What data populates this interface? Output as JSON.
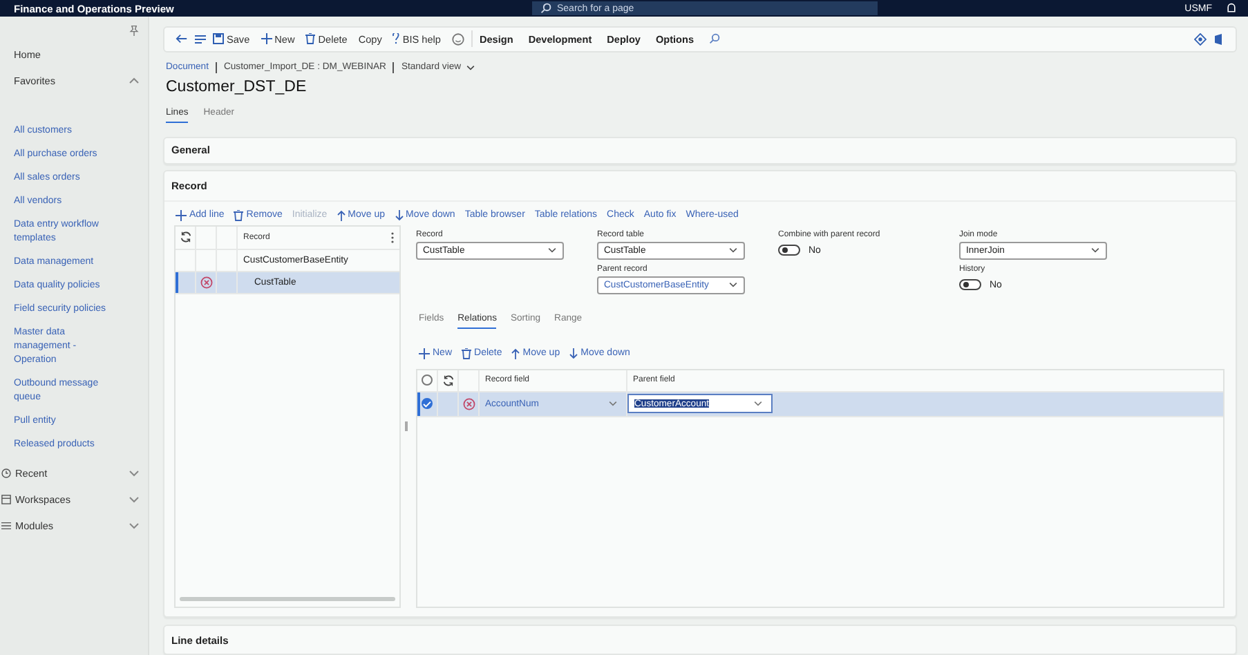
{
  "top_bar": {
    "app_title": "Finance and Operations Preview",
    "search": {
      "placeholder": "Search for a page"
    },
    "company": "USMF"
  },
  "sidebar": {
    "home": "Home",
    "favorites": {
      "label": "Favorites",
      "expanded": true,
      "items": [
        "All customers",
        "All purchase orders",
        "All sales orders",
        "All vendors",
        "Data entry workflow templates",
        "Data management",
        "Data quality policies",
        "Field security policies",
        "Master data management - Operation",
        "Outbound message queue",
        "Pull entity",
        "Released products"
      ]
    },
    "groups": [
      {
        "label": "Recent",
        "kind": "clock",
        "expanded": false
      },
      {
        "label": "Workspaces",
        "kind": "board",
        "expanded": false
      },
      {
        "label": "Modules",
        "kind": "list",
        "expanded": false
      }
    ]
  },
  "toolbar": {
    "actions": [
      {
        "label": "Save",
        "kind": "save"
      },
      {
        "label": "New",
        "kind": "plus"
      },
      {
        "label": "Delete",
        "kind": "trash"
      },
      {
        "label": "Copy",
        "kind": "plain"
      },
      {
        "label": "BIS help",
        "kind": "question"
      }
    ],
    "menus": [
      "Design",
      "Development",
      "Deploy",
      "Options"
    ]
  },
  "breadcrumb": {
    "link": "Document",
    "context": "Customer_Import_DE : DM_WEBINAR",
    "view": "Standard view"
  },
  "title": "Customer_DST_DE",
  "page_tabs": [
    {
      "label": "Lines",
      "selected": true
    },
    {
      "label": "Header",
      "selected": false
    }
  ],
  "general": {
    "title": "General"
  },
  "record": {
    "title": "Record",
    "actions": [
      {
        "label": "Add line",
        "kind": "plus",
        "disabled": false
      },
      {
        "label": "Remove",
        "kind": "trash",
        "disabled": false
      },
      {
        "label": "Initialize",
        "kind": "plain",
        "disabled": true
      },
      {
        "label": "Move up",
        "kind": "up",
        "disabled": false
      },
      {
        "label": "Move down",
        "kind": "down",
        "disabled": false
      },
      {
        "label": "Table browser",
        "kind": "plain",
        "disabled": false
      },
      {
        "label": "Table relations",
        "kind": "plain",
        "disabled": false
      },
      {
        "label": "Check",
        "kind": "plain",
        "disabled": false
      },
      {
        "label": "Auto fix",
        "kind": "plain",
        "disabled": false
      },
      {
        "label": "Where-used",
        "kind": "plain",
        "disabled": false
      }
    ],
    "grid": {
      "column": "Record",
      "rows": [
        {
          "name": "CustCustomerBaseEntity",
          "selected": false,
          "error": false,
          "children": [
            {
              "name": "CustTable",
              "selected": true,
              "error": true
            }
          ]
        }
      ]
    },
    "form": {
      "record": {
        "label": "Record",
        "value": "CustTable"
      },
      "record_table": {
        "label": "Record table",
        "value": "CustTable"
      },
      "parent_record": {
        "label": "Parent record",
        "value": "CustCustomerBaseEntity"
      },
      "combine": {
        "label": "Combine with parent record",
        "on": false,
        "text": "No"
      },
      "join_mode": {
        "label": "Join mode",
        "value": "InnerJoin"
      },
      "history": {
        "label": "History",
        "on": false,
        "text": "No"
      }
    },
    "sub_tabs": [
      {
        "label": "Fields",
        "selected": false
      },
      {
        "label": "Relations",
        "selected": true
      },
      {
        "label": "Sorting",
        "selected": false
      },
      {
        "label": "Range",
        "selected": false
      }
    ],
    "sub_actions": [
      {
        "label": "New",
        "kind": "plus"
      },
      {
        "label": "Delete",
        "kind": "trash"
      },
      {
        "label": "Move up",
        "kind": "up"
      },
      {
        "label": "Move down",
        "kind": "down"
      }
    ],
    "relations": {
      "all_selected": false,
      "columns": [
        "Record field",
        "Parent field"
      ],
      "rows": [
        {
          "selected": true,
          "error": true,
          "record_field": "AccountNum",
          "parent_field": "CustomerAccount"
        }
      ]
    }
  },
  "line_details": {
    "title": "Line details"
  }
}
